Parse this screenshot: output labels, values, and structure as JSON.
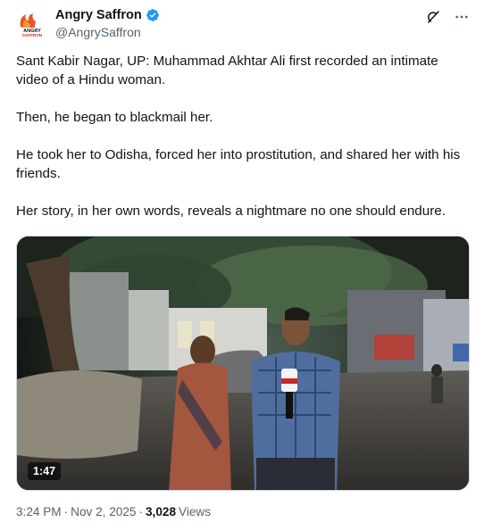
{
  "author": {
    "display_name": "Angry Saffron",
    "handle": "@AngrySaffron",
    "avatar_icon": "angry-saffron-logo",
    "avatar_logo_text": "ANGRY SAFFRON",
    "verified_icon": "verified-badge-icon",
    "verified_color": "#1d9bf0"
  },
  "actions": {
    "grok_icon": "grok-icon",
    "more_icon": "more-options-icon"
  },
  "post": {
    "paragraphs": [
      "Sant Kabir Nagar, UP: Muhammad Akhtar Ali first recorded an intimate video of a Hindu woman.",
      "Then, he began to blackmail her.",
      "He took her to Odisha, forced her into prostitution, and shared her with his friends.",
      "Her story, in her own words, reveals a nightmare no one should endure."
    ]
  },
  "media": {
    "type": "video",
    "duration": "1:47"
  },
  "meta": {
    "time": "3:24 PM",
    "separator": "·",
    "date": "Nov 2, 2025",
    "views_count": "3,028",
    "views_label": "Views"
  },
  "colors": {
    "text": "#0f1419",
    "secondary": "#536471",
    "border": "#cfd9de"
  }
}
